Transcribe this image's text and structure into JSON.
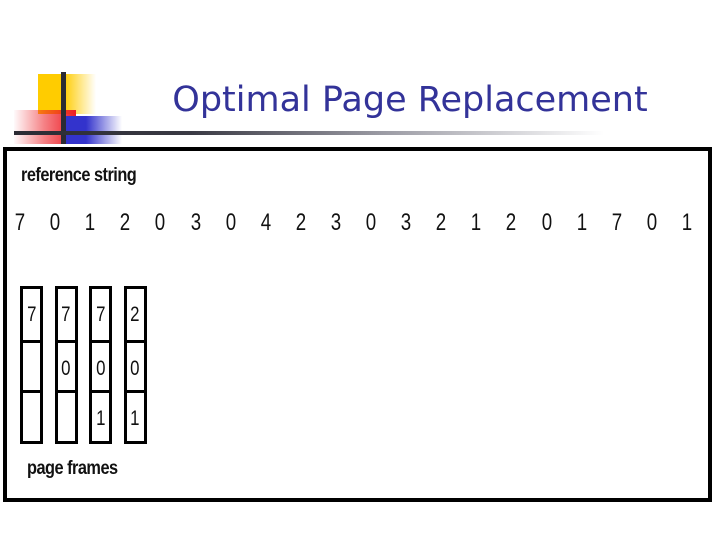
{
  "slide": {
    "title": "Optimal Page Replacement",
    "title_color": "#333399",
    "background_color": "#FFFFFF"
  },
  "decoration": {
    "yellow_color": "#FFCC00",
    "red_color": "#ED1C24",
    "blue_color": "#3333CC",
    "line_color": "#2B2B33"
  },
  "figure": {
    "reference_string_label": "reference string",
    "page_frames_label": "page frames",
    "border_color": "#000000",
    "reference_string": [
      "7",
      "0",
      "1",
      "2",
      "0",
      "3",
      "0",
      "4",
      "2",
      "3",
      "0",
      "3",
      "2",
      "1",
      "2",
      "0",
      "1",
      "7",
      "0",
      "1"
    ],
    "page_frames": [
      {
        "cells": [
          "7",
          "",
          ""
        ]
      },
      {
        "cells": [
          "7",
          "0",
          ""
        ]
      },
      {
        "cells": [
          "7",
          "0",
          "1"
        ]
      },
      {
        "cells": [
          "2",
          "0",
          "1"
        ]
      }
    ]
  }
}
